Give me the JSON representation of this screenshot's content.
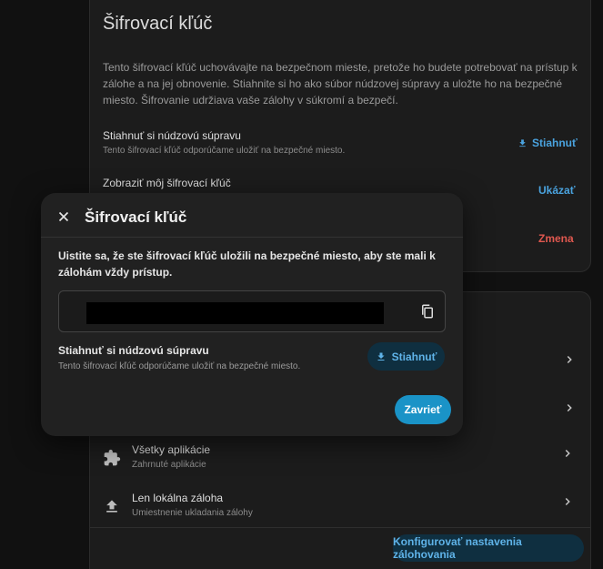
{
  "encryption_card": {
    "title": "Šifrovací kľúč",
    "description": "Tento šifrovací kľúč uchovávajte na bezpečnom mieste, pretože ho budete potrebovať na prístup k zálohe a na jej obnovenie. Stiahnite si ho ako súbor núdzovej súpravy a uložte ho na bezpečné miesto. Šifrovanie udržiava vaše zálohy v súkromí a bezpečí.",
    "download_row": {
      "title": "Stiahnuť si núdzovú súpravu",
      "subtitle": "Tento šifrovací kľúč odporúčame uložiť na bezpečné miesto.",
      "button": "Stiahnuť"
    },
    "show_row": {
      "title": "Zobraziť môj šifrovací kľúč",
      "button": "Ukázať"
    },
    "change_row": {
      "button": "Zmena"
    }
  },
  "settings_card": {
    "items": [
      {
        "title": "Všetky aplikácie",
        "subtitle": "Zahrnuté aplikácie",
        "icon": "puzzle-icon"
      },
      {
        "title": "Len lokálna záloha",
        "subtitle": "Umiestnenie ukladania zálohy",
        "icon": "upload-icon"
      }
    ],
    "configure_button": "Konfigurovať nastavenia zálohovania"
  },
  "dialog": {
    "title": "Šifrovací kľúč",
    "text": "Uistite sa, že ste šifrovací kľúč uložili na bezpečné miesto, aby ste mali k zálohám vždy prístup.",
    "row_title": "Stiahnuť si núdzovú súpravu",
    "row_subtitle": "Tento šifrovací kľúč odporúčame uložiť na bezpečné miesto.",
    "download_button": "Stiahnuť",
    "close_button": "Zavrieť"
  },
  "colors": {
    "accent": "#1a93c7",
    "link": "#4aa3df",
    "danger": "#e0584f"
  }
}
